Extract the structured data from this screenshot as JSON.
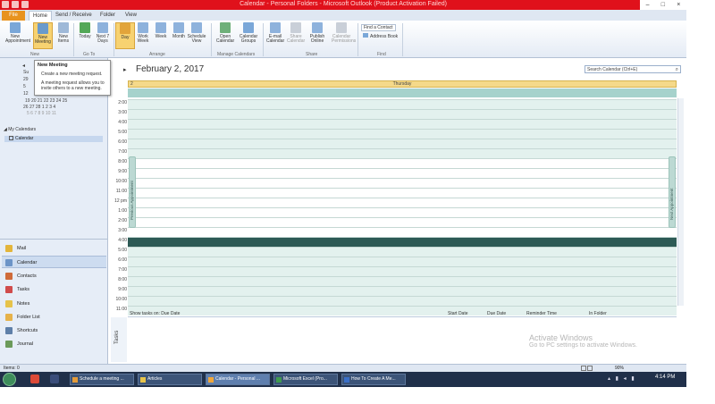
{
  "window": {
    "title": "Calendar - Personal Folders - Microsoft Outlook (Product Activation Failed)",
    "controls": [
      "–",
      "□",
      "×"
    ]
  },
  "tabs": {
    "file": "File",
    "items": [
      "Home",
      "Send / Receive",
      "Folder",
      "View"
    ]
  },
  "ribbon": {
    "buttons": {
      "new_appointment": "New Appointment",
      "new_meeting": "New Meeting",
      "new_items": "New Items",
      "today": "Today",
      "next7": "Next 7 Days",
      "day": "Day",
      "work_week": "Work Week",
      "week": "Week",
      "month": "Month",
      "schedule_view": "Schedule View",
      "open_calendar": "Open Calendar",
      "calendar_groups": "Calendar Groups",
      "email_calendar": "E-mail Calendar",
      "share_calendar": "Share Calendar",
      "publish_online": "Publish Online",
      "calendar_permissions": "Calendar Permissions"
    },
    "groups": [
      "New",
      "Go To",
      "Arrange",
      "Manage Calendars",
      "Share",
      "Find"
    ],
    "find_contact": "Find a Contact",
    "address_book": "Address Book"
  },
  "tooltip": {
    "title": "New Meeting",
    "line1": "Create a new meeting request.",
    "line2": "A meeting request allows you to invite others to a new meeting."
  },
  "mini_calendar": {
    "rows": [
      "Su",
      "29",
      "5",
      "12",
      "19  20  21  22  23  24  25",
      "26  27  28   1   2   3   4",
      "5   6   7   8   9  10  11"
    ]
  },
  "navigation": {
    "my_calendars": "My Calendars",
    "calendar_item": "Calendar",
    "buttons": [
      "Mail",
      "Calendar",
      "Contacts",
      "Tasks",
      "Notes",
      "Folder List",
      "Shortcuts",
      "Journal"
    ]
  },
  "calendar": {
    "date": "February 2, 2017",
    "day_number": "2",
    "weekday": "Thursday",
    "search_placeholder": "Search Calendar (Ctrl+E)",
    "times": [
      "2:00",
      "3:00",
      "4:00",
      "5:00",
      "6:00",
      "7:00",
      "8:00",
      "9:00",
      "10:00",
      "11:00",
      "12 pm",
      "1:00",
      "2:00",
      "3:00",
      "4:00",
      "5:00",
      "6:00",
      "7:00",
      "8:00",
      "9:00",
      "10:00",
      "11:00"
    ],
    "previous_appointment": "Previous Appointment",
    "next_appointment": "Next Appointment"
  },
  "tasks": {
    "label": "Tasks",
    "show_tasks": "Show tasks on: Due Date",
    "start_date": "Start Date",
    "due_date": "Due Date",
    "reminder_time": "Reminder Time",
    "in_folder": "In Folder"
  },
  "watermark": {
    "line1": "Activate Windows",
    "line2": "Go to PC settings to activate Windows."
  },
  "statusbar": {
    "items": "Items: 0",
    "zoom": "90%"
  },
  "taskbar": {
    "items": [
      "Schedule a meeting ...",
      "Articles",
      "Calendar - Personal ...",
      "Microsoft Excel (Pro...",
      "How To Create A Me..."
    ],
    "clock": "4:14 PM"
  }
}
